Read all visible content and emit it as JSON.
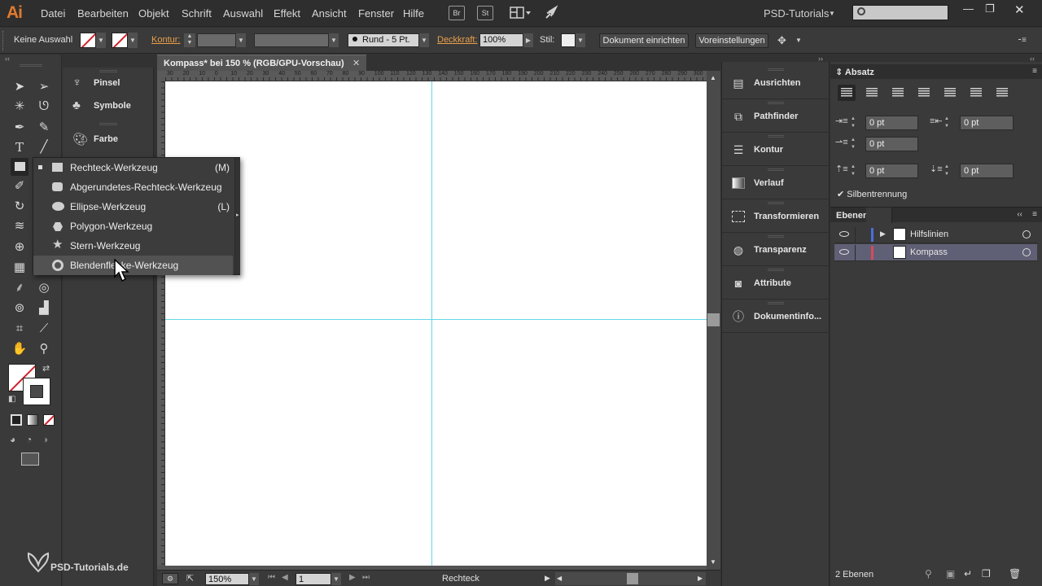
{
  "app": {
    "logo": "Ai",
    "menu": [
      "Datei",
      "Bearbeiten",
      "Objekt",
      "Schrift",
      "Auswahl",
      "Effekt",
      "Ansicht",
      "Fenster",
      "Hilfe"
    ],
    "bridge_button": "Br",
    "stock_button": "St",
    "workspace": "PSD-Tutorials",
    "search_placeholder": ""
  },
  "control_bar": {
    "selection": "Keine Auswahl",
    "stroke_label": "Kontur:",
    "brush_label": "Rund - 5 Pt.",
    "opacity_label": "Deckkraft:",
    "opacity_value": "100%",
    "style_label": "Stil:",
    "doc_setup_button": "Dokument einrichten",
    "preferences_button": "Voreinstellungen"
  },
  "document": {
    "tab_title": "Kompass* bei 150 % (RGB/GPU-Vorschau)",
    "ruler_numbers": [
      "30",
      "20",
      "10",
      "0",
      "10",
      "20",
      "30",
      "40",
      "50",
      "60",
      "70",
      "80",
      "90",
      "100",
      "110",
      "120",
      "130",
      "140",
      "150",
      "160",
      "170",
      "180",
      "190",
      "200",
      "210",
      "220",
      "230",
      "240",
      "250",
      "260",
      "270",
      "280",
      "290",
      "300"
    ]
  },
  "status_bar": {
    "zoom": "150%",
    "artboard": "1",
    "tool_name": "Rechteck"
  },
  "left_panels": [
    {
      "label": "Pinsel",
      "icon": "brush-icon"
    },
    {
      "label": "Symbole",
      "icon": "club-icon"
    },
    {
      "label": "Farbe",
      "icon": "palette-icon"
    }
  ],
  "flyout": [
    {
      "label": "Rechteck-Werkzeug",
      "key": "(M)",
      "icon": "rectangle-icon"
    },
    {
      "label": "Abgerundetes-Rechteck-Werkzeug",
      "key": "",
      "icon": "rounded-rectangle-icon"
    },
    {
      "label": "Ellipse-Werkzeug",
      "key": "(L)",
      "icon": "ellipse-icon"
    },
    {
      "label": "Polygon-Werkzeug",
      "key": "",
      "icon": "polygon-icon"
    },
    {
      "label": "Stern-Werkzeug",
      "key": "",
      "icon": "star-icon"
    },
    {
      "label": "Blendenflecke-Werkzeug",
      "key": "",
      "icon": "flare-icon"
    }
  ],
  "mid_panels": [
    {
      "label": "Ausrichten",
      "icon": "align-icon"
    },
    {
      "label": "Pathfinder",
      "icon": "pathfinder-icon"
    },
    {
      "label": "Kontur",
      "icon": "stroke-icon"
    },
    {
      "label": "Verlauf",
      "icon": "gradient-icon"
    },
    {
      "label": "Transformieren",
      "icon": "transform-icon"
    },
    {
      "label": "Transparenz",
      "icon": "transparency-icon"
    },
    {
      "label": "Attribute",
      "icon": "attributes-icon"
    },
    {
      "label": "Dokumentinfo...",
      "icon": "document-info-icon"
    }
  ],
  "paragraph_panel": {
    "title": "Absatz",
    "left_indent": "0 pt",
    "right_indent": "0 pt",
    "first_line_indent": "0 pt",
    "space_before": "0 pt",
    "space_after": "0 pt",
    "hyphenation_label": "Silbentrennung",
    "hyphenation_checked": true
  },
  "layers_panel": {
    "title": "Ebenen",
    "layers": [
      {
        "name": "Hilfslinien",
        "color": "#4a6fd8",
        "selected": false
      },
      {
        "name": "Kompass",
        "color": "#d84a5a",
        "selected": true
      }
    ],
    "count_label": "2 Ebenen"
  }
}
